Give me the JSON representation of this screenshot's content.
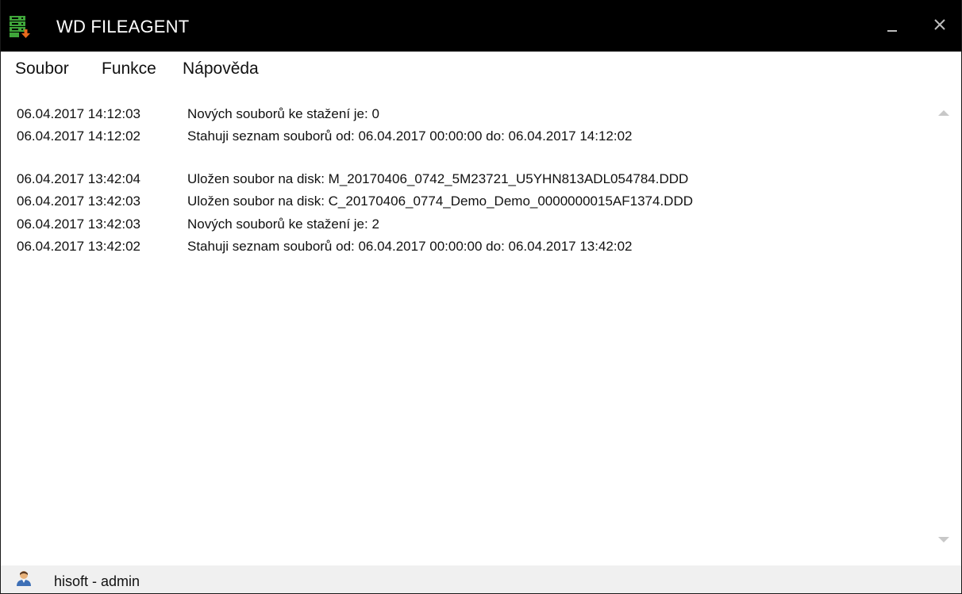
{
  "window": {
    "title": "WD FILEAGENT",
    "app_icon": "server-download-icon",
    "minimize_icon": "minimize-icon",
    "close_icon": "close-icon"
  },
  "menu": {
    "items": [
      {
        "label": "Soubor"
      },
      {
        "label": "Funkce"
      },
      {
        "label": "Nápověda"
      }
    ]
  },
  "log": {
    "entries": [
      {
        "time": "06.04.2017 14:12:03",
        "message": "Nových souborů ke stažení je: 0"
      },
      {
        "time": "06.04.2017 14:12:02",
        "message": "Stahuji seznam souborů od: 06.04.2017 00:00:00 do: 06.04.2017 14:12:02"
      },
      {
        "time": "06.04.2017 13:42:04",
        "message": "Uložen soubor na disk: M_20170406_0742_5M23721_U5YHN813ADL054784.DDD"
      },
      {
        "time": "06.04.2017 13:42:03",
        "message": "Uložen soubor na disk: C_20170406_0774_Demo_Demo_0000000015AF1374.DDD"
      },
      {
        "time": "06.04.2017 13:42:03",
        "message": "Nových souborů ke stažení je: 2"
      },
      {
        "time": "06.04.2017 13:42:02",
        "message": "Stahuji seznam souborů od: 06.04.2017 00:00:00 do: 06.04.2017 13:42:02"
      }
    ]
  },
  "status": {
    "user": "hisoft - admin",
    "user_icon": "user-icon"
  },
  "colors": {
    "titlebar_bg": "#000000",
    "app_icon_green": "#3fa63a",
    "app_icon_orange": "#e86a1c",
    "statusbar_bg": "#f0f0f0",
    "scroll_arrow": "#c8c8c8"
  }
}
